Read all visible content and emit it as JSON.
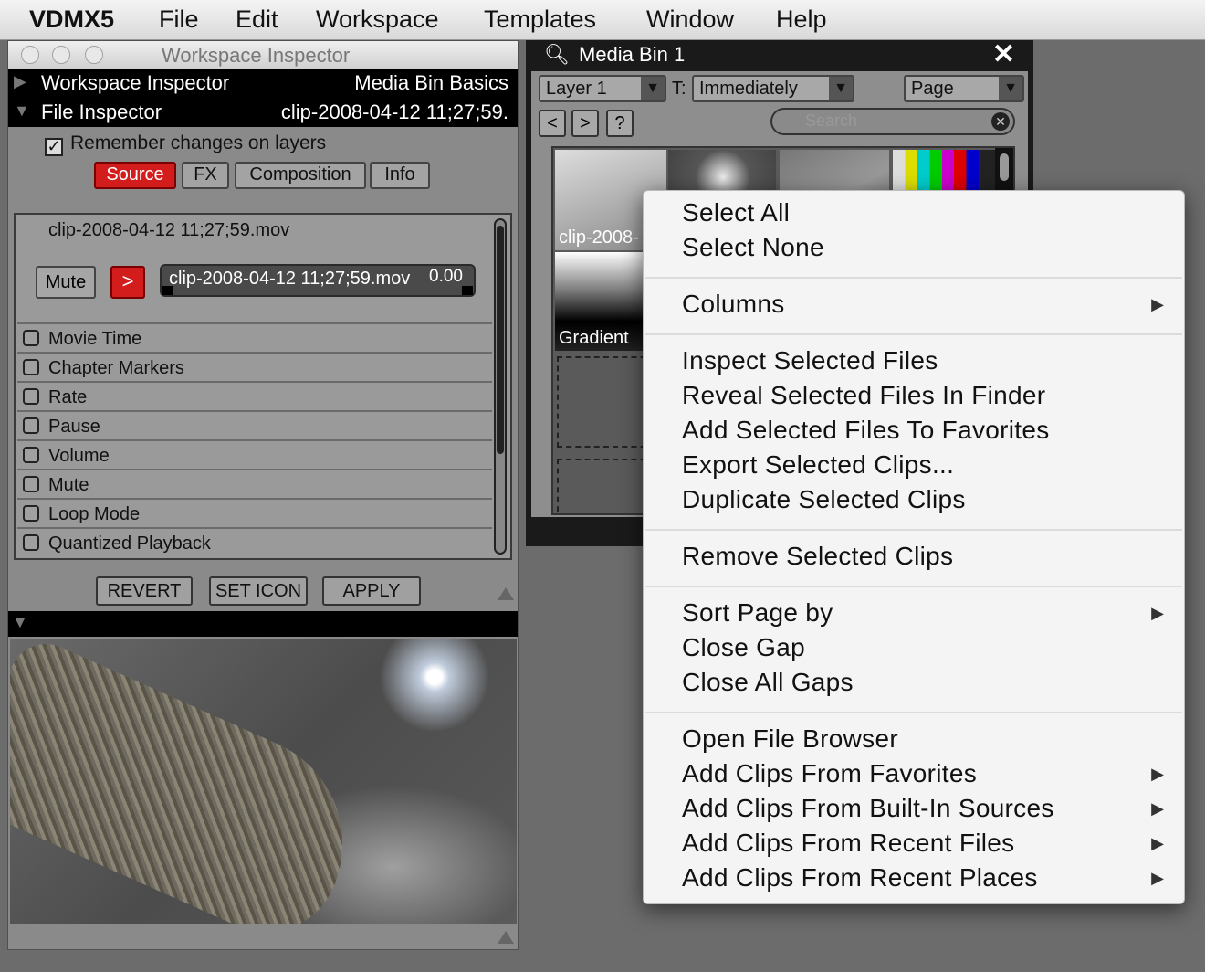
{
  "menubar": {
    "app": "VDMX5",
    "items": [
      "File",
      "Edit",
      "Workspace",
      "Templates",
      "Window",
      "Help"
    ]
  },
  "inspector": {
    "window_title": "Workspace Inspector",
    "section1_left": "Workspace Inspector",
    "section1_right": "Media Bin Basics",
    "section2_left": "File Inspector",
    "section2_right": "clip-2008-04-12 11;27;59.",
    "remember_label": "Remember changes on layers",
    "tabs": [
      "Source",
      "FX",
      "Composition",
      "Info"
    ],
    "clip_name": "clip-2008-04-12 11;27;59.mov",
    "mute_label": "Mute",
    "play_label": ">",
    "scrub_file": "clip-2008-04-12 11;27;59.mov",
    "scrub_time": "0.00",
    "properties": [
      "Movie Time",
      "Chapter Markers",
      "Rate",
      "Pause",
      "Volume",
      "Mute",
      "Loop Mode",
      "Quantized Playback"
    ],
    "revert_label": "REVERT",
    "set_icon_label": "SET ICON",
    "apply_label": "APPLY"
  },
  "mediabin": {
    "title": "Media Bin 1",
    "layer_select": "Layer 1",
    "t_label": "T:",
    "trigger_select": "Immediately",
    "page_select": "Page",
    "prev_label": "<",
    "next_label": ">",
    "help_label": "?",
    "search_placeholder": "Search",
    "clip1_label": "clip-2008-",
    "clip2_label": "Gradient"
  },
  "context_menu": {
    "items": {
      "select_all": "Select All",
      "select_none": "Select None",
      "columns": "Columns",
      "inspect": "Inspect Selected Files",
      "reveal": "Reveal Selected Files In Finder",
      "add_fav": "Add Selected Files To Favorites",
      "export": "Export Selected Clips...",
      "duplicate": "Duplicate Selected Clips",
      "remove": "Remove Selected Clips",
      "sort": "Sort Page by",
      "close_gap": "Close Gap",
      "close_all": "Close All Gaps",
      "open_browser": "Open File Browser",
      "from_fav": "Add Clips From Favorites",
      "from_builtin": "Add Clips From Built-In Sources",
      "from_recent_files": "Add Clips From Recent Files",
      "from_recent_places": "Add Clips From Recent Places"
    }
  },
  "colors": {
    "accent_red": "#d31d1d",
    "bar_black": "#000000"
  }
}
